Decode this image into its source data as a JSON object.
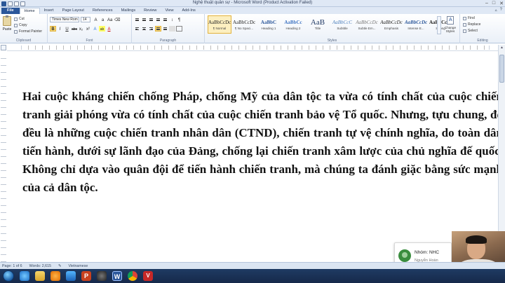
{
  "window": {
    "title": "Nghệ thuật quân sự - Microsoft Word (Product Activation Failed)",
    "controls": [
      "–",
      "□",
      "✕"
    ]
  },
  "tabs": [
    "File",
    "Home",
    "Insert",
    "Page Layout",
    "References",
    "Mailings",
    "Review",
    "View",
    "Add-Ins"
  ],
  "ribbon": {
    "clipboard": {
      "label": "Clipboard",
      "paste": "Paste",
      "cut": "Cut",
      "copy": "Copy",
      "format_painter": "Format Painter"
    },
    "font": {
      "label": "Font",
      "font_name": "Times New Rom",
      "font_size": "14",
      "buttons": [
        "B",
        "I",
        "U",
        "abc",
        "x₂",
        "x²",
        "A",
        "ab",
        "A"
      ]
    },
    "paragraph": {
      "label": "Paragraph"
    },
    "styles": {
      "label": "Styles",
      "items": [
        {
          "sample": "AaBbCcDc",
          "name": "¶ Normal"
        },
        {
          "sample": "AaBbCcDc",
          "name": "¶ No Spaci..."
        },
        {
          "sample": "AaBbC",
          "name": "Heading 1"
        },
        {
          "sample": "AaBbCc",
          "name": "Heading 2"
        },
        {
          "sample": "AaB",
          "name": "Title"
        },
        {
          "sample": "AaBbCcC",
          "name": "Subtitle"
        },
        {
          "sample": "AaBbCcDc",
          "name": "Subtle Em..."
        },
        {
          "sample": "AaBbCcDc",
          "name": "Emphasis"
        },
        {
          "sample": "AaBbCcDc",
          "name": "Intense E..."
        },
        {
          "sample": "AaBbCcDc",
          "name": "Strong"
        },
        {
          "sample": "AaBbCcl",
          "name": "Quote"
        }
      ],
      "change_styles": "Change Styles"
    },
    "editing": {
      "label": "Editing",
      "find": "Find",
      "replace": "Replace",
      "select": "Select"
    }
  },
  "document": {
    "paragraph": "Hai cuộc kháng chiến chống Pháp, chống Mỹ của dân tộc ta vừa có tính chất của cuộc chiến tranh giải phóng vừa có tính chất của cuộc chiến tranh bảo vệ Tổ quốc. Nhưng, tựu chung, đó đều là những cuộc chiến tranh nhân dân (CTND), chiến tranh tự vệ chính nghĩa, do toàn dân tiến hành, dưới sự lãnh đạo của Đảng, chống lại chiến tranh xâm lược của chủ nghĩa đế quốc. Không chỉ dựa vào quân đội để tiến hành chiến tranh, mà chúng ta đánh giặc bằng sức mạnh của cả dân tộc."
  },
  "notification": {
    "title": "Nhóm: NHC",
    "subtitle": "Nguyễn Hoàn"
  },
  "statusbar": {
    "page": "Page: 1 of 6",
    "words": "Words: 2,615",
    "language": "Vietnamese"
  },
  "colors": {
    "file_tab": "#2b579a",
    "ribbon_highlight": "#fbdc7b",
    "taskbar": "#1f3b63"
  }
}
